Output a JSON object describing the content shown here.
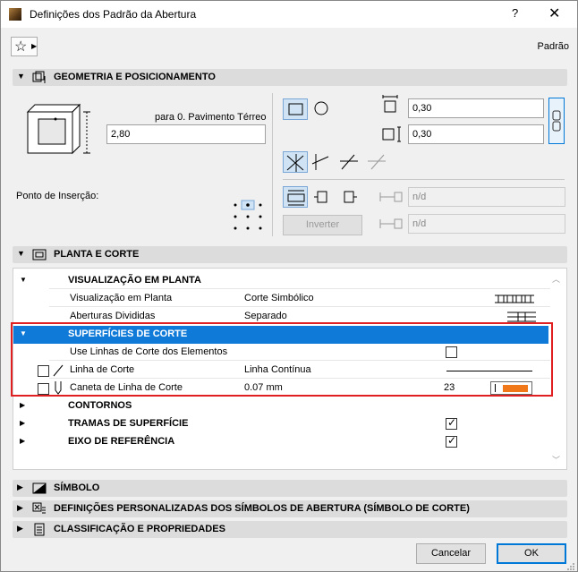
{
  "window": {
    "title": "Definições dos Padrão da Abertura",
    "help": "?",
    "close": "✕"
  },
  "toolbar": {
    "favorites_label": "☆",
    "default_label": "Padrão"
  },
  "sections": {
    "geometry": "GEOMETRIA E POSICIONAMENTO",
    "plan": "PLANTA E CORTE",
    "symbol": "SÍMBOLO",
    "custom": "DEFINIÇÕES PERSONALIZADAS DOS SÍMBOLOS DE ABERTURA  (SÍMBOLO DE CORTE)",
    "classification": "CLASSIFICAÇÃO E PROPRIEDADES"
  },
  "geometry": {
    "story_label": "para 0. Pavimento Térreo",
    "elevation_value": "2,80",
    "width_value": "0,30",
    "height_value": "0,30",
    "insertion_label": "Ponto de Inserção:",
    "reveal1_value": "n/d",
    "reveal2_value": "n/d",
    "invert_label": "Inverter"
  },
  "plan": {
    "rows": [
      {
        "label": "VISUALIZAÇÃO EM PLANTA",
        "value": ""
      },
      {
        "label": "Visualização em Planta",
        "value": "Corte Simbólico"
      },
      {
        "label": "Aberturas Divididas",
        "value": "Separado"
      },
      {
        "label": "SUPERFÍCIES DE CORTE",
        "value": ""
      },
      {
        "label": "Use Linhas de Corte dos Elementos",
        "value": ""
      },
      {
        "label": "Linha de Corte",
        "value": "Linha Contínua"
      },
      {
        "label": "Caneta de Linha de Corte",
        "value": "0.07 mm",
        "pen": "23"
      },
      {
        "label": "CONTORNOS",
        "value": ""
      },
      {
        "label": "TRAMAS DE SUPERFÍCIE",
        "value": ""
      },
      {
        "label": "EIXO DE REFERÊNCIA",
        "value": ""
      }
    ],
    "pen_color": "#f07818"
  },
  "buttons": {
    "cancel": "Cancelar",
    "ok": "OK"
  },
  "colors": {
    "selection": "#0f7ad8",
    "highlight_border": "#e02020",
    "ok_border": "#0078d7"
  }
}
